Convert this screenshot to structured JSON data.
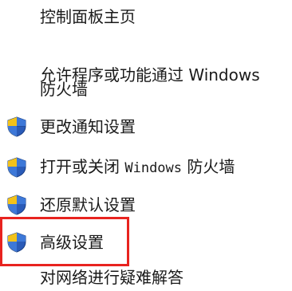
{
  "task_pane": {
    "items": [
      {
        "label": "控制面板主页",
        "icon": null
      },
      {
        "label_line1": "允许程序或功能通过 Windows",
        "label_line2": "防火墙",
        "icon": null
      },
      {
        "label": "更改通知设置",
        "icon": "uac-shield-icon"
      },
      {
        "label_prefix": "打开或关闭 ",
        "label_mono": "Windows",
        "label_suffix": " 防火墙",
        "icon": "uac-shield-icon"
      },
      {
        "label": "还原默认设置",
        "icon": "uac-shield-icon"
      },
      {
        "label": "高级设置",
        "icon": "uac-shield-icon",
        "highlighted": true
      },
      {
        "label": "对网络进行疑难解答",
        "icon": null
      }
    ]
  },
  "colors": {
    "highlight_border": "#e8231f",
    "shield_blue": "#2a5bb8",
    "shield_yellow": "#f2c21a",
    "text": "#1a1a1a"
  }
}
